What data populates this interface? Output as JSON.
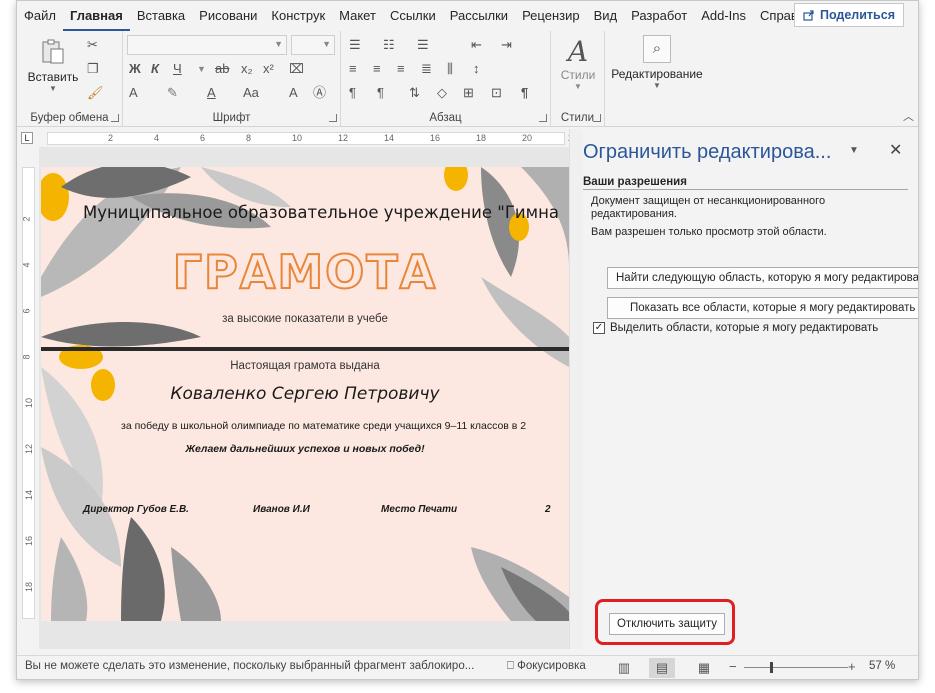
{
  "tabs": [
    "Файл",
    "Главная",
    "Вставка",
    "Рисовани",
    "Конструк",
    "Макет",
    "Ссылки",
    "Рассылки",
    "Рецензир",
    "Вид",
    "Разработ",
    "Add-Ins",
    "Справка"
  ],
  "active_tab": "Главная",
  "share_label": "Поделиться",
  "ribbon": {
    "clipboard": {
      "paste_label": "Вставить",
      "group_label": "Буфер обмена"
    },
    "font": {
      "group_label": "Шрифт",
      "bold": "Ж",
      "italic": "К",
      "underline": "Ч",
      "strike": "ab",
      "subscript": "x₂",
      "superscript": "x²",
      "font_size_up": "A",
      "case": "Aa"
    },
    "paragraph": {
      "group_label": "Абзац",
      "pilcrow": "¶"
    },
    "styles": {
      "label": "Стили",
      "group_label": "Стили"
    },
    "editing": {
      "label": "Редактирование"
    }
  },
  "ruler_ticks": [
    "2",
    "4",
    "6",
    "8",
    "10",
    "12",
    "14",
    "16",
    "18",
    "20",
    "22"
  ],
  "vruler_ticks": [
    "2",
    "4",
    "6",
    "8",
    "10",
    "12",
    "14",
    "16",
    "18"
  ],
  "certificate": {
    "org": "Муниципальное образовательное учреждение \"Гимна",
    "title": "ГРАМОТА",
    "subtitle": "за высокие показатели в учебе",
    "issued": "Настоящая грамота выдана",
    "name": "Коваленко Сергею Петровичу",
    "reason": "за победу в школьной олимпиаде по математике среди учащихся 9–11 классов в 2",
    "wish": "Желаем дальнейших успехов и новых побед!",
    "signatures": [
      "Директор Губов Е.В.",
      "Иванов И.И",
      "Место Печати",
      "2"
    ]
  },
  "pane": {
    "title": "Ограничить редактирова...",
    "section": "Ваши разрешения",
    "protected_text": "Документ защищен от несанкционированного редактирования.",
    "view_only_text": "Вам разрешен только просмотр этой области.",
    "find_next_button": "Найти следующую область, которую я могу редактировать",
    "show_all_button": "Показать все области, которые я могу редактировать",
    "highlight_checkbox": "Выделить области, которые я могу редактировать",
    "highlight_checked": true,
    "stop_protection_button": "Отключить защиту"
  },
  "status": {
    "message": "Вы не можете сделать это изменение, поскольку выбранный фрагмент заблокиро...",
    "focus": "Фокусировка",
    "zoom": "57 %"
  },
  "colors": {
    "accent": "#2b579a",
    "title_outline": "#e8863a",
    "page_bg": "#fce8e1",
    "highlight_ring": "#e02020"
  }
}
